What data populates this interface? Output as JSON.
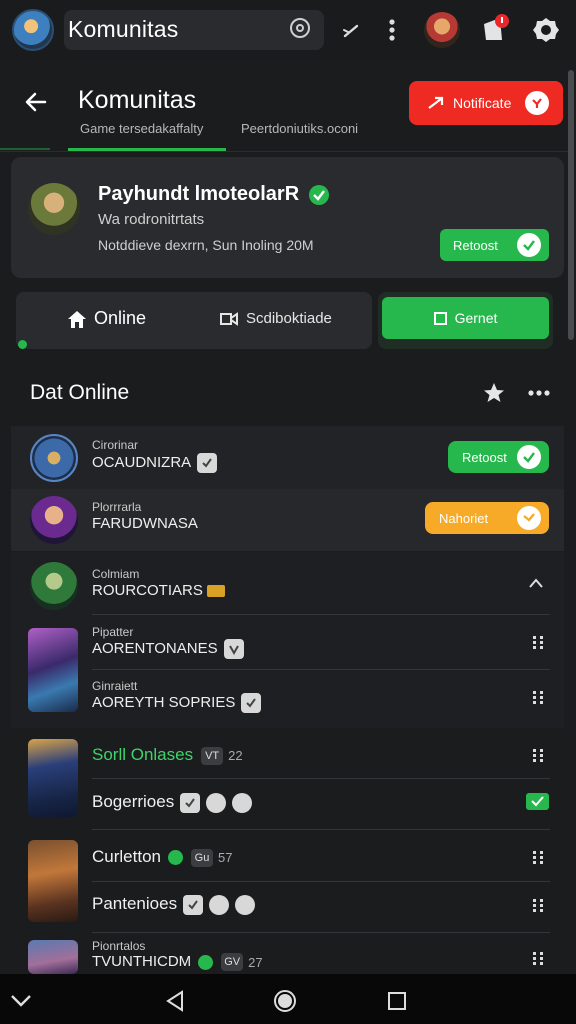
{
  "app": {
    "title": "Komunitas"
  },
  "header": {
    "title": "Komunitas",
    "notify_label": "Notificate",
    "tabs": [
      {
        "label": "Game tersedakaffalty"
      },
      {
        "label": "Peertdoniutiks.oconi"
      }
    ]
  },
  "profile": {
    "name": "Payhundt lmoteolarR",
    "subtitle": "Wa rodronitrtats",
    "meta": "Notddieve dexrrn, Sun Inoling 20M",
    "action_label": "Retoost"
  },
  "segments": {
    "online": "Online",
    "broadcast": "Scdiboktiade",
    "green": "Gernet"
  },
  "section": {
    "title": "Dat Online"
  },
  "people": [
    {
      "role": "Cirorinar",
      "name": "OCAUDNIZRA",
      "action": "Retoost"
    },
    {
      "role": "Plorrrarla",
      "name": "FARUDWNASA",
      "action": "Nahoriet"
    },
    {
      "role": "Colmiam",
      "name": "ROURCOTIARS"
    },
    {
      "role": "Pipatter",
      "name": "AORENTONANES"
    },
    {
      "role": "Ginraiett",
      "name": "AOREYTH SOPRIES"
    }
  ],
  "games": [
    {
      "name": "Sorll Onlases",
      "tag": "VT",
      "count": "22",
      "sub": "Bogerrioes"
    },
    {
      "name": "Curletton",
      "tag": "Gu",
      "count": "57",
      "sub": "Pantenioes"
    },
    {
      "role": "Pionrtalos",
      "name": "TVUNTHICDM",
      "tag": "GV",
      "count": "27"
    }
  ],
  "colors": {
    "accent": "#27b84d",
    "danger": "#ef2a22",
    "warning": "#f7a928",
    "background": "#1b1c1e"
  },
  "icons": [
    "search-icon",
    "pen-icon",
    "kebab-icon",
    "notification-icon",
    "gear-icon",
    "back-icon",
    "verified-icon",
    "home-icon",
    "broadcast-icon",
    "star-icon",
    "more-icon",
    "grip-icon",
    "check-icon",
    "nav-back-icon",
    "nav-home-icon",
    "nav-recents-icon"
  ]
}
